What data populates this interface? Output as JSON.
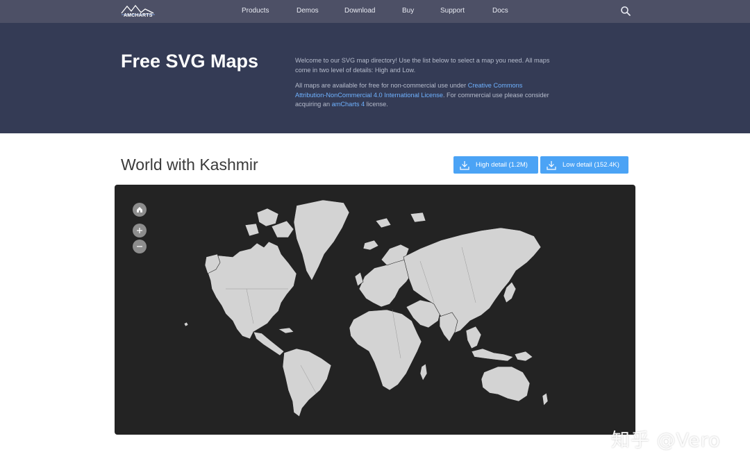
{
  "header": {
    "logo_text": "AMCHARTS",
    "nav": [
      "Products",
      "Demos",
      "Download",
      "Buy",
      "Support",
      "Docs"
    ]
  },
  "hero": {
    "title": "Free SVG Maps",
    "para1": "Welcome to our SVG map directory! Use the list below to select a map you need. All maps come in two level of details: High and Low.",
    "para2_prefix": "All maps are available for free for non-commercial use under ",
    "para2_link": "Creative Commons Attribution-NonCommercial 4.0 International License",
    "para2_mid": ". For commercial use please consider acquiring an ",
    "para2_link2": "amCharts 4",
    "para2_suffix": " license."
  },
  "map_section": {
    "title": "World with Kashmir",
    "high_btn": "High detail (1.2M)",
    "low_btn": "Low detail (152.4K)"
  },
  "watermark": "知乎 @Vero",
  "colors": {
    "nav_bg": "#4d5066",
    "hero_bg": "#343b55",
    "button": "#4ba3f5",
    "map_bg": "#232323",
    "land": "#d3d3d3"
  }
}
